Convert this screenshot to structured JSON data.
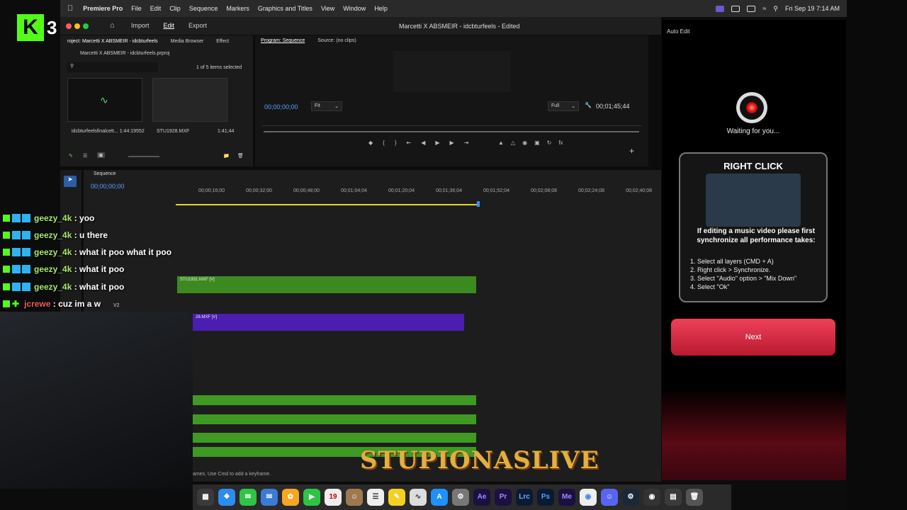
{
  "menubar": {
    "app": "Premiere Pro",
    "items": [
      "File",
      "Edit",
      "Clip",
      "Sequence",
      "Markers",
      "Graphics and Titles",
      "View",
      "Window",
      "Help"
    ],
    "clock": "Fri Sep 19  7:14 AM"
  },
  "window": {
    "title": "Marcetti X ABSMEIR - idcbturfeels",
    "edited": "Edited",
    "tabs": [
      "Import",
      "Edit",
      "Export"
    ]
  },
  "project": {
    "tabs": [
      "roject: Marcetti X ABSMEIR - idcbturfeels",
      "Media Browser",
      "Effect"
    ],
    "file": "Marcetti X ABSMEIR - idcbturfeels.prproj",
    "selection": "1 of 5 items selected",
    "items": [
      {
        "name": "idcbturfeelsfinalcett...",
        "duration": "1:44:19552"
      },
      {
        "name": "STU1928.MXF",
        "duration": "1:41;44"
      }
    ]
  },
  "program": {
    "tabs": [
      "Program: Sequence",
      "Source: (no clips)"
    ],
    "timecode": "00;00;00;00",
    "fit": "Fit",
    "quality": "Full",
    "duration": "00;01;45;44"
  },
  "timeline": {
    "tab": "Sequence",
    "timecode": "00;00;00;00",
    "ticks": [
      "00;00;16;00",
      "00;00;32;00",
      "00;00;48;00",
      "00;01;04;04",
      "00;01;20;04",
      "00;01;36;04",
      "00;01;52;04",
      "00;02;08;08",
      "00;02;24;08",
      "00;02;40;08"
    ],
    "clips": [
      "STU1931.MXF [V]",
      "28.MXF [V]"
    ],
    "track_label": "V2",
    "status": "ames. Use Cmd to add a keyframe."
  },
  "extension": {
    "panel": "Auto Edit",
    "waiting": "Waiting for you...",
    "card_title": "RIGHT CLICK",
    "instruction": "If editing a music video please first synchronize all performance takes:",
    "steps": [
      "1. Select all layers (CMD + A)",
      "2. Right click > Synchronize.",
      "3. Select \"Audio\" option > \"Mix Down\"",
      "4. Select \"Ok\""
    ],
    "next": "Next"
  },
  "stream": {
    "logo_number": "3",
    "watermark": "STUPIONASLIVE",
    "chat": [
      {
        "user": "geezy_4k",
        "msg": ": yoo"
      },
      {
        "user": "geezy_4k",
        "msg": ": u there"
      },
      {
        "user": "geezy_4k",
        "msg": ": what it poo what it poo"
      },
      {
        "user": "geezy_4k",
        "msg": ": what it poo"
      },
      {
        "user": "geezy_4k",
        "msg": ": what it poo"
      },
      {
        "user": "jcrewe",
        "msg": ": cuz im a w"
      }
    ]
  },
  "dock": {
    "labels": [
      "Ae",
      "Pr",
      "Lrc",
      "Ps",
      "Me"
    ],
    "calendar_day": "19"
  },
  "colors": {
    "accent": "#2a5ea8",
    "video_clip": "#3c8a1f",
    "purple_clip": "#4b1db0",
    "next_button": "#e83a52",
    "kick_green": "#53fc18"
  }
}
